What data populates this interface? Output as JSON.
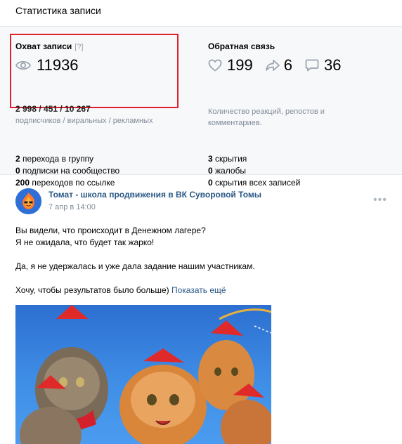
{
  "header": {
    "title": "Статистика записи"
  },
  "reach": {
    "title": "Охват записи",
    "help": "[?]",
    "total": "11936",
    "breakdown": "2 998 / 451 / 10 267",
    "breakdown_caption": "подписчиков / виральных / рекламных"
  },
  "feedback": {
    "title": "Обратная связь",
    "likes": "199",
    "reposts": "6",
    "comments": "36",
    "description": "Количество реакций, репостов и комментариев."
  },
  "metrics_left": [
    {
      "value": "2",
      "label": " перехода в группу"
    },
    {
      "value": "0",
      "label": " подписки на сообщество"
    },
    {
      "value": "200",
      "label": " переходов по ссылке"
    }
  ],
  "metrics_right": [
    {
      "value": "3",
      "label": " скрытия"
    },
    {
      "value": "0",
      "label": " жалобы"
    },
    {
      "value": "0",
      "label": " скрытия всех записей"
    }
  ],
  "post": {
    "author": "Томат - школа продвижения в ВК Суворовой Томы",
    "date": "7 апр в 14:00",
    "lines": [
      "Вы видели, что происходит в Денежном лагере?",
      "Я не ожидала, что будет так жарко!",
      "Да, я не удержалась и уже дала задание нашим участникам.",
      "Хочу, чтобы результатов было больше)"
    ],
    "show_more": "Показать ещё",
    "more_icon": "•••"
  },
  "colors": {
    "accent": "#2a5885",
    "highlight": "#e0202e",
    "muted": "#818c99"
  }
}
